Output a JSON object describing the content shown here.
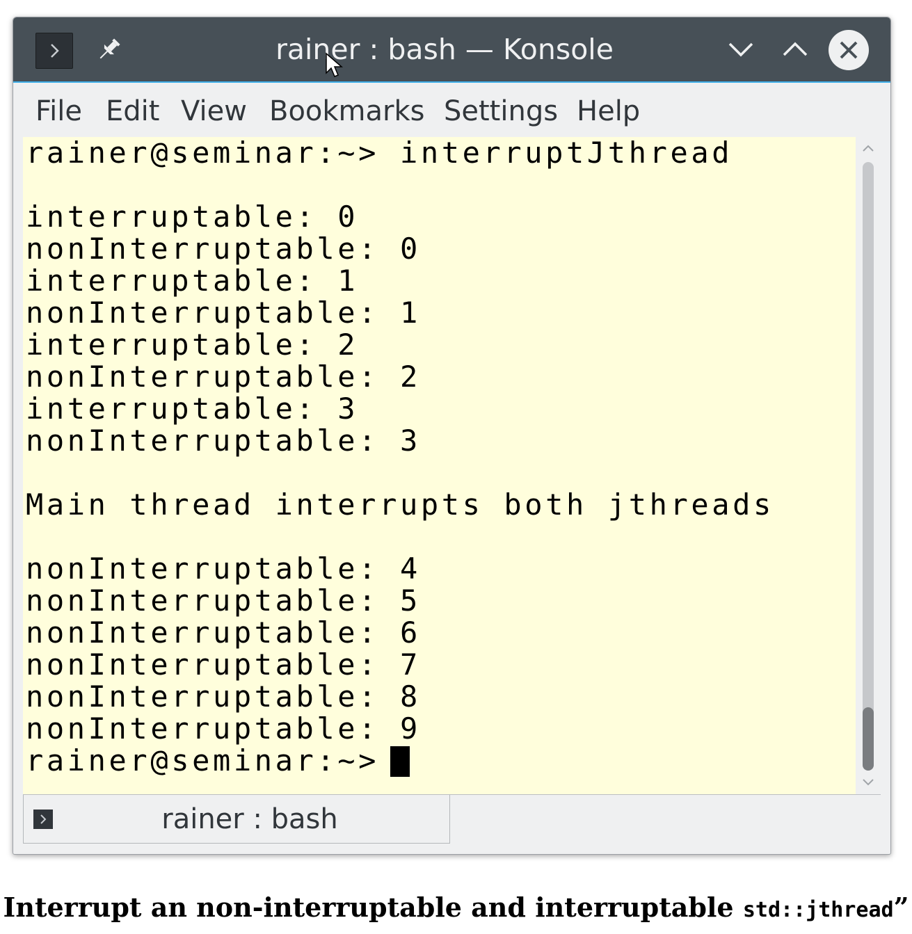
{
  "window": {
    "title": "rainer : bash — Konsole",
    "accent_color": "#3daee9",
    "titlebar_color": "#475057"
  },
  "titlebar_icons": [
    "terminal-icon",
    "pin-icon",
    "minimize-chevron-icon",
    "maximize-chevron-icon",
    "close-icon"
  ],
  "menu": [
    "File",
    "Edit",
    "View",
    "Bookmarks",
    "Settings",
    "Help"
  ],
  "terminal": {
    "background": "#fffedc",
    "lines": [
      "rainer@seminar:~> interruptJthread",
      "",
      "interruptable: 0",
      "nonInterruptable: 0",
      "interruptable: 1",
      "nonInterruptable: 1",
      "interruptable: 2",
      "nonInterruptable: 2",
      "interruptable: 3",
      "nonInterruptable: 3",
      "",
      "Main thread interrupts both jthreads",
      "",
      "nonInterruptable: 4",
      "nonInterruptable: 5",
      "nonInterruptable: 6",
      "nonInterruptable: 7",
      "nonInterruptable: 8",
      "nonInterruptable: 9",
      "rainer@seminar:~> "
    ]
  },
  "tab": {
    "label": "rainer : bash"
  },
  "caption": {
    "text": "Interrupt an non-interruptable and interruptable ",
    "code": "std::jthread",
    "suffix": "”"
  }
}
